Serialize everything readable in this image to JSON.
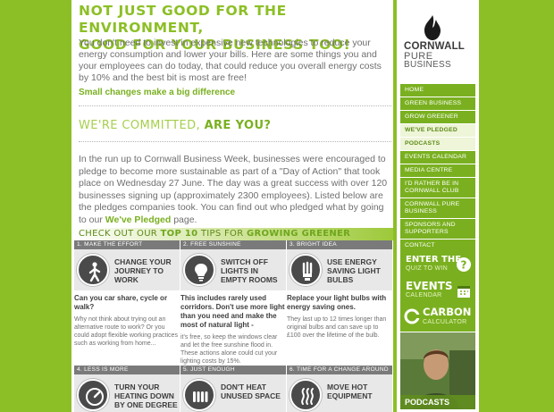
{
  "main": {
    "headline_1": "NOT JUST GOOD FOR THE ENVIRONMENT,",
    "headline_2": "GOOD FOR YOUR BUSINESS TOO!",
    "intro": "You don't need to invest in expensive new technologies to reduce your energy consumption and lower your bills. Here are some things you and your employees can do today, that could reduce you overall energy costs by 10% and the best bit is most are free!",
    "small_changes_link": "Small changes make a big difference",
    "committed_prefix": "WE'RE COMMITTED,",
    "committed_bold": "ARE YOU?",
    "body_text": "In the run up to Cornwall Business Week, businesses were encouraged to pledge to become more sustainable as part of a \"Day of Action\" that took place on Wednesday 27 June. The day was a great success with over 120 businesses signing up (approximately 2300 employees). Listed below are the pledges companies took. You can find out who pledged what by going to our",
    "body_link": "We've Pledged",
    "body_end": "page.",
    "tips_prefix": "CHECK OUT OUR",
    "tips_bold": "TOP 10",
    "tips_mid": "TIPS FOR",
    "tips_green": "GROWING GREENER"
  },
  "tips": [
    {
      "label": "1. MAKE THE EFFORT",
      "title": "CHANGE YOUR JOURNEY TO WORK",
      "icon": "walking-person-icon",
      "question": "Can you car share, cycle or walk?",
      "answer": "Why not think about trying out an alternative route to work? Or you could adopt flexible working practices such as working from home..."
    },
    {
      "label": "2. FREE SUNSHINE",
      "title": "SWITCH OFF LIGHTS IN EMPTY ROOMS",
      "icon": "lightbulb-icon",
      "question": "This includes rarely used corridors. Don't use more light than you need and make the most of natural light -",
      "answer": "it's free, so keep the windows clear and let the free sunshine flood in. These actions alone could cut your lighting costs by 15%."
    },
    {
      "label": "3. BRIGHT IDEA",
      "title": "USE ENERGY SAVING LIGHT BULBS",
      "icon": "energy-saving-bulb-icon",
      "question": "Replace your light bulbs with energy saving ones.",
      "answer": "They last up to 12 times longer than original bulbs and can save up to £100 over the lifetime of the bulb."
    },
    {
      "label": "4. LESS IS MORE",
      "title": "TURN YOUR HEATING DOWN BY ONE DEGREE",
      "icon": "thermostat-dial-icon",
      "question": "",
      "answer": ""
    },
    {
      "label": "5. JUST ENOUGH",
      "title": "DON'T HEAT UNUSED SPACE",
      "icon": "radiator-icon",
      "question": "",
      "answer": ""
    },
    {
      "label": "6. TIME FOR A CHANGE AROUND",
      "title": "MOVE HOT EQUIPMENT",
      "icon": "heat-waves-icon",
      "question": "",
      "answer": ""
    }
  ],
  "sidebar": {
    "logo_line1": "CORNWALL",
    "logo_line2": "PURE",
    "logo_line3": "BUSINESS",
    "nav": [
      {
        "label": "HOME",
        "sub": false
      },
      {
        "label": "GREEN BUSINESS",
        "sub": false
      },
      {
        "label": "GROW GREENER",
        "sub": false
      },
      {
        "label": "WE'VE PLEDGED",
        "sub": true
      },
      {
        "label": "PODCASTS",
        "sub": true
      },
      {
        "label": "EVENTS CALENDAR",
        "sub": false
      },
      {
        "label": "MEDIA CENTRE",
        "sub": false
      },
      {
        "label": "I'D RATHER BE IN CORNWALL CLUB",
        "sub": false
      },
      {
        "label": "CORNWALL PURE BUSINESS",
        "sub": false
      },
      {
        "label": "SPONSORS AND SUPPORTERS",
        "sub": false
      },
      {
        "label": "CONTACT",
        "sub": false
      }
    ],
    "promo_quiz_title": "ENTER THE",
    "promo_quiz_sub": "QUIZ TO WIN",
    "promo_events_title": "EVENTS",
    "promo_events_sub": "CALENDAR",
    "promo_carbon_title": "CARBON",
    "promo_carbon_sub": "CALCULATOR",
    "podcasts_label": "PODCASTS"
  },
  "colors": {
    "brand_green": "#7ab020",
    "light_green": "#8cbf26",
    "tip_label": "#7a7a7a"
  }
}
